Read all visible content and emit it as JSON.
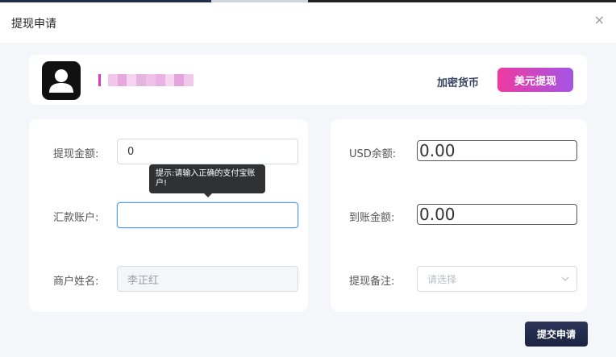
{
  "dialog": {
    "title": "提现申请",
    "close_glyph": "×"
  },
  "profile": {
    "crypto_tab": "加密货币",
    "usd_button": "美元提现",
    "avatar_icon": "user-silhouette-icon",
    "redacted_colors": [
      "#d83cc0",
      "#f2c6ea",
      "#e8a7dd",
      "#f6d3ef",
      "#e6b4e0",
      "#f0c0e8",
      "#eab2e2",
      "#f5d6f0",
      "#e2a4da",
      "#f0c8ea"
    ]
  },
  "form_left": {
    "amount_label": "提现金额:",
    "amount_value": "0",
    "tooltip_text": "提示:请输入正确的支付宝账户!",
    "account_label": "汇款账户:",
    "account_value": "",
    "merchant_label": "商户姓名:",
    "merchant_value": "李正红"
  },
  "form_right": {
    "usd_balance_label": "USD余额:",
    "usd_balance_value": "0.00",
    "received_label": "到账金额:",
    "received_value": "0.00",
    "remark_label": "提现备注:",
    "remark_placeholder": "请选择"
  },
  "actions": {
    "submit_label": "提交申请"
  },
  "colors": {
    "accent_gradient_start": "#ee3a9f",
    "accent_gradient_end": "#a455e6",
    "submit_bg": "#232b4a",
    "focus_border": "#5b9fe0"
  }
}
